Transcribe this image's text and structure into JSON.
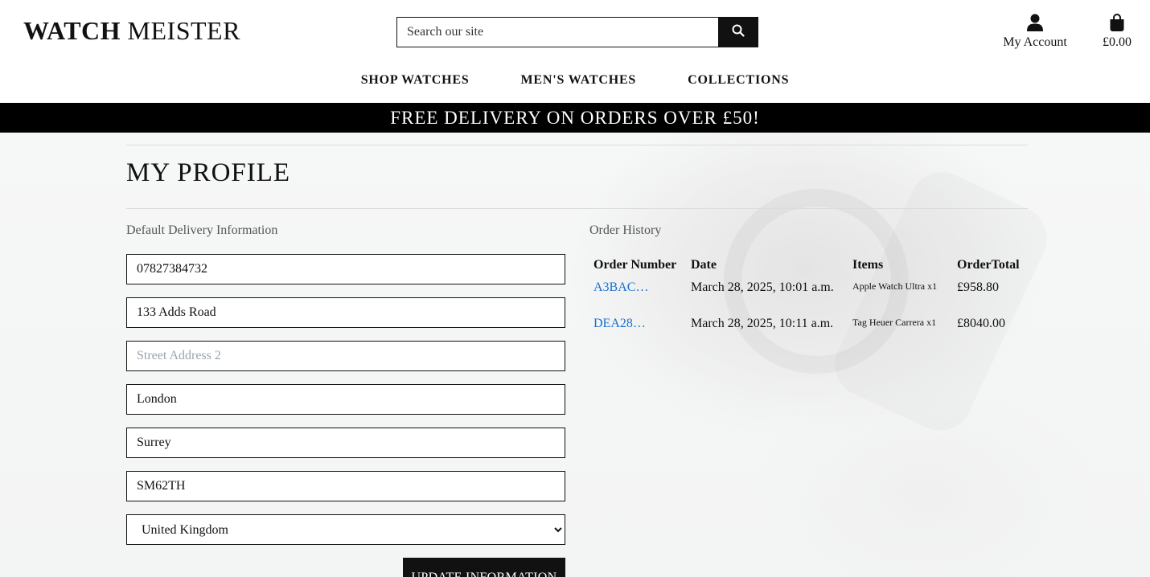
{
  "header": {
    "logo_bold": "WATCH",
    "logo_rest": "MEISTER",
    "search_placeholder": "Search our site",
    "account_label": "My Account",
    "bag_total": "£0.00"
  },
  "nav": {
    "items": [
      {
        "label": "SHOP WATCHES"
      },
      {
        "label": "MEN'S WATCHES"
      },
      {
        "label": "COLLECTIONS"
      }
    ]
  },
  "banner": {
    "text": "FREE DELIVERY ON ORDERS OVER £50!"
  },
  "profile": {
    "title": "MY PROFILE",
    "delivery_label": "Default Delivery Information",
    "fields": {
      "phone": "07827384732",
      "street1": "133 Adds Road",
      "street2_placeholder": "Street Address 2",
      "town": "London",
      "county": "Surrey",
      "postcode": "SM62TH",
      "country": "United Kingdom"
    },
    "update_button": "UPDATE INFORMATION"
  },
  "orders": {
    "label": "Order History",
    "headers": [
      "Order Number",
      "Date",
      "Items",
      "OrderTotal"
    ],
    "rows": [
      {
        "number": "A3BAC…",
        "date": "March 28, 2025, 10:01 a.m.",
        "items": "Apple Watch Ultra x1",
        "total": "£958.80"
      },
      {
        "number": "DEA28…",
        "date": "March 28, 2025, 10:11 a.m.",
        "items": "Tag Heuer Carrera x1",
        "total": "£8040.00"
      }
    ]
  },
  "icons": {
    "search": "search-icon",
    "account": "user-icon",
    "bag": "shopping-bag-icon"
  }
}
